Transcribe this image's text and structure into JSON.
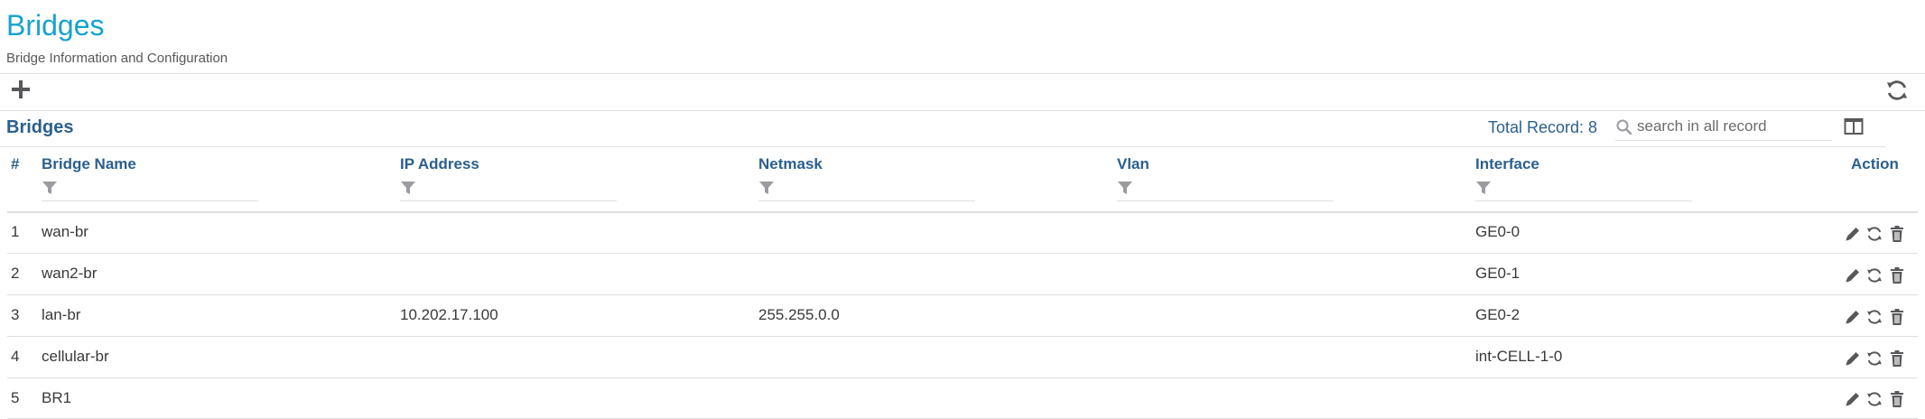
{
  "page": {
    "title": "Bridges",
    "subtitle": "Bridge Information and Configuration"
  },
  "toolbar": {
    "add_icon": "plus-icon",
    "refresh_icon": "refresh-icon"
  },
  "table": {
    "title": "Bridges",
    "total_record": "Total Record: 8",
    "search_placeholder": "search in all record",
    "columns": {
      "index": "#",
      "bridge_name": "Bridge Name",
      "ip_address": "IP Address",
      "netmask": "Netmask",
      "vlan": "Vlan",
      "interface": "Interface",
      "action": "Action"
    },
    "rows": [
      {
        "index": "1",
        "bridge_name": "wan-br",
        "ip_address": "",
        "netmask": "",
        "vlan": "",
        "interface": "GE0-0"
      },
      {
        "index": "2",
        "bridge_name": "wan2-br",
        "ip_address": "",
        "netmask": "",
        "vlan": "",
        "interface": "GE0-1"
      },
      {
        "index": "3",
        "bridge_name": "lan-br",
        "ip_address": "10.202.17.100",
        "netmask": "255.255.0.0",
        "vlan": "",
        "interface": "GE0-2"
      },
      {
        "index": "4",
        "bridge_name": "cellular-br",
        "ip_address": "",
        "netmask": "",
        "vlan": "",
        "interface": "int-CELL-1-0"
      },
      {
        "index": "5",
        "bridge_name": "BR1",
        "ip_address": "",
        "netmask": "",
        "vlan": "",
        "interface": ""
      }
    ]
  },
  "colors": {
    "title": "#16a2cf",
    "header_text": "#2b5f8e",
    "icon": "#58585b",
    "filter_icon": "#9a9ca0",
    "divider": "#dfdfdf"
  }
}
